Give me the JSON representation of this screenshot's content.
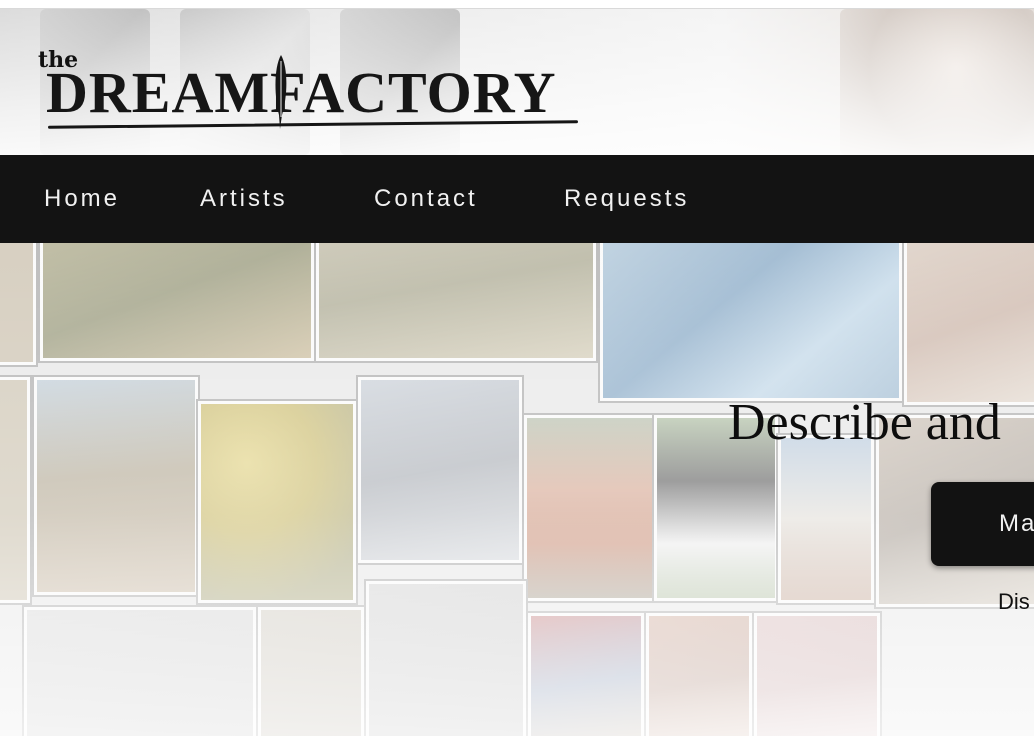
{
  "brand": {
    "small_word": "the",
    "name": "DREAMFACTORY"
  },
  "nav": {
    "items": [
      {
        "label": "Home"
      },
      {
        "label": "Artists"
      },
      {
        "label": "Contact"
      },
      {
        "label": "Requests"
      }
    ]
  },
  "hero": {
    "title": "Describe and",
    "cta_label": "Ma",
    "subtext": "Dis"
  },
  "colors": {
    "nav_background": "#131313",
    "nav_text": "#f1f1f1",
    "button_background": "#121212",
    "page_background": "#f2f2f2"
  },
  "icons": [
    "quill-icon"
  ]
}
